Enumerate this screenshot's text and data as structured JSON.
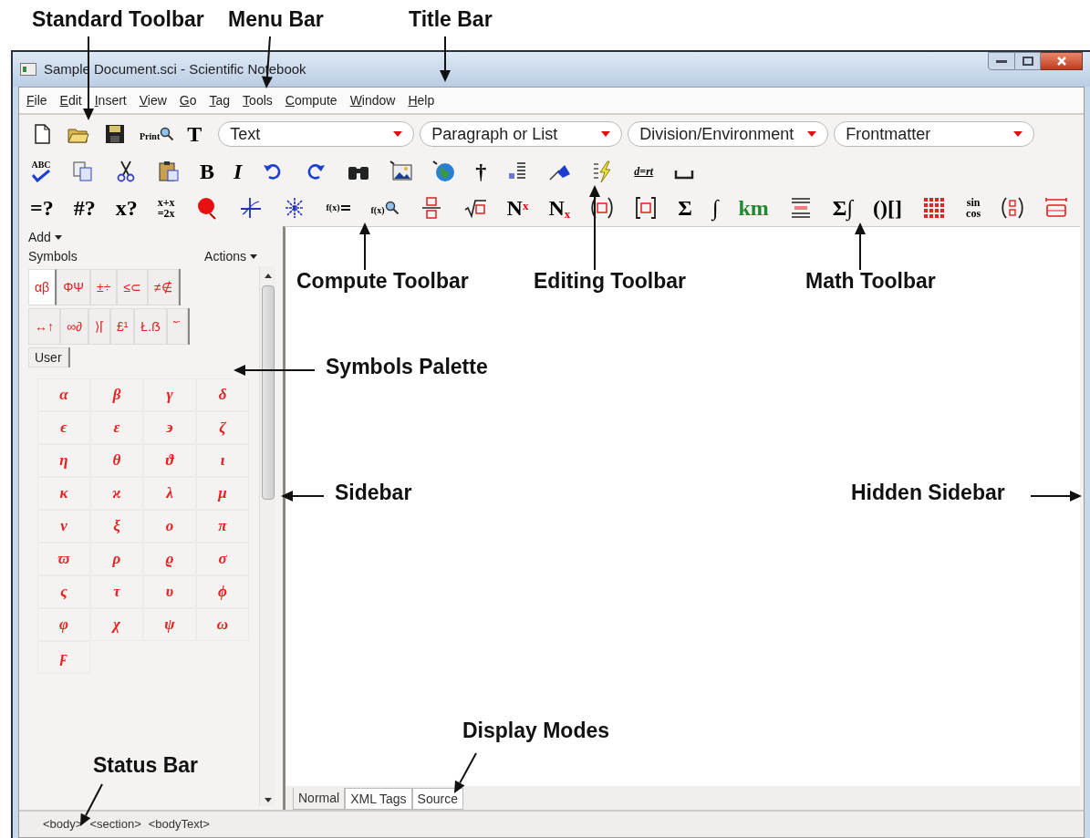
{
  "window": {
    "title": "Sample Document.sci - Scientific Notebook"
  },
  "menu": [
    "File",
    "Edit",
    "Insert",
    "View",
    "Go",
    "Tag",
    "Tools",
    "Compute",
    "Window",
    "Help"
  ],
  "toolbars": [
    {
      "items": [
        {
          "kind": "icon"
        },
        {
          "kind": "icon"
        },
        {
          "kind": "icon"
        },
        {
          "kind": "iconlabel",
          "label": "Print"
        },
        {
          "kind": "glyph",
          "label": "T"
        }
      ],
      "dropdowns": [
        {
          "value": "Text"
        },
        {
          "value": "Paragraph or List"
        },
        {
          "value": "Division/Environment"
        },
        {
          "value": "Frontmatter"
        }
      ]
    },
    {
      "items": [
        {
          "kind": "iconlabel",
          "label": "ABC"
        },
        {
          "kind": "icon"
        },
        {
          "kind": "icon"
        },
        {
          "kind": "icon"
        },
        {
          "kind": "glyph",
          "label": "B"
        },
        {
          "kind": "italic",
          "label": "I"
        },
        {
          "kind": "icon"
        },
        {
          "kind": "icon"
        },
        {
          "kind": "icon"
        },
        {
          "kind": "icon"
        },
        {
          "kind": "icon"
        },
        {
          "kind": "glyph",
          "label": "†"
        },
        {
          "kind": "icon"
        },
        {
          "kind": "icon"
        },
        {
          "kind": "icon"
        },
        {
          "kind": "small",
          "label": "d=rt"
        },
        {
          "kind": "icon"
        }
      ]
    },
    {
      "items": [
        {
          "kind": "glyph",
          "label": "=?"
        },
        {
          "kind": "glyph",
          "label": "#?"
        },
        {
          "kind": "glyph",
          "label": "x?"
        },
        {
          "kind": "stack",
          "lines": [
            "x+x",
            "=2x"
          ]
        },
        {
          "kind": "icon"
        },
        {
          "kind": "icon"
        },
        {
          "kind": "icon"
        },
        {
          "kind": "iconlabel",
          "label": "f(x)"
        },
        {
          "kind": "iconlabel",
          "label": "f(x)"
        },
        {
          "kind": "icon"
        },
        {
          "kind": "icon"
        },
        {
          "kind": "glyph",
          "label": "N$^{x}$"
        },
        {
          "kind": "glyph",
          "label": "N$_{x}$"
        },
        {
          "kind": "icon"
        },
        {
          "kind": "icon"
        },
        {
          "kind": "glyph",
          "label": "Σ"
        },
        {
          "kind": "glyph",
          "label": "∫"
        },
        {
          "kind": "glyph",
          "label": "km",
          "color": "#1f8a2e"
        },
        {
          "kind": "icon"
        },
        {
          "kind": "glyph",
          "label": "Σ∫"
        },
        {
          "kind": "glyph",
          "label": "()[]"
        },
        {
          "kind": "icon"
        },
        {
          "kind": "stack",
          "lines": [
            "sin",
            "cos"
          ]
        },
        {
          "kind": "icon"
        },
        {
          "kind": "icon"
        }
      ]
    }
  ],
  "sidebar": {
    "add": "Add",
    "title": "Symbols",
    "actions": "Actions",
    "tab_rows": [
      [
        {
          "label": "αβ",
          "selected": true
        },
        {
          "label": "ΦΨ",
          "selected": false
        },
        {
          "label": "±÷",
          "selected": false
        },
        {
          "label": "≤⊂",
          "selected": false
        },
        {
          "label": "≠∉",
          "selected": false
        }
      ],
      [
        {
          "label": "↔↑",
          "selected": false
        },
        {
          "label": "∞∂",
          "selected": false
        },
        {
          "label": "⟩⌈",
          "selected": false
        },
        {
          "label": "£¹",
          "selected": false
        },
        {
          "label": "Ł.ẞ",
          "selected": false
        },
        {
          "label": "˜˙",
          "selected": false
        }
      ],
      [
        {
          "label": "User",
          "selected": false
        }
      ]
    ],
    "symbols": [
      "α",
      "β",
      "γ",
      "δ",
      "ϵ",
      "ε",
      "϶",
      "ζ",
      "η",
      "θ",
      "ϑ",
      "ι",
      "κ",
      "ϰ",
      "λ",
      "μ",
      "ν",
      "ξ",
      "ο",
      "π",
      "ϖ",
      "ρ",
      "ϱ",
      "σ",
      "ς",
      "τ",
      "υ",
      "ϕ",
      "φ",
      "χ",
      "ψ",
      "ω",
      "ϝ"
    ]
  },
  "display_modes": [
    {
      "label": "Normal",
      "selected": true
    },
    {
      "label": "XML Tags",
      "selected": false
    },
    {
      "label": "Source",
      "selected": false
    }
  ],
  "status_bar": [
    "<body>",
    "<section>",
    "<bodyText>"
  ],
  "annotations": [
    {
      "text": "Standard Toolbar"
    },
    {
      "text": "Menu Bar"
    },
    {
      "text": "Title Bar"
    },
    {
      "text": "Compute Toolbar"
    },
    {
      "text": "Editing Toolbar"
    },
    {
      "text": "Math Toolbar"
    },
    {
      "text": "Symbols Palette"
    },
    {
      "text": "Sidebar"
    },
    {
      "text": "Hidden Sidebar"
    },
    {
      "text": "Display Modes"
    },
    {
      "text": "Status Bar"
    }
  ]
}
